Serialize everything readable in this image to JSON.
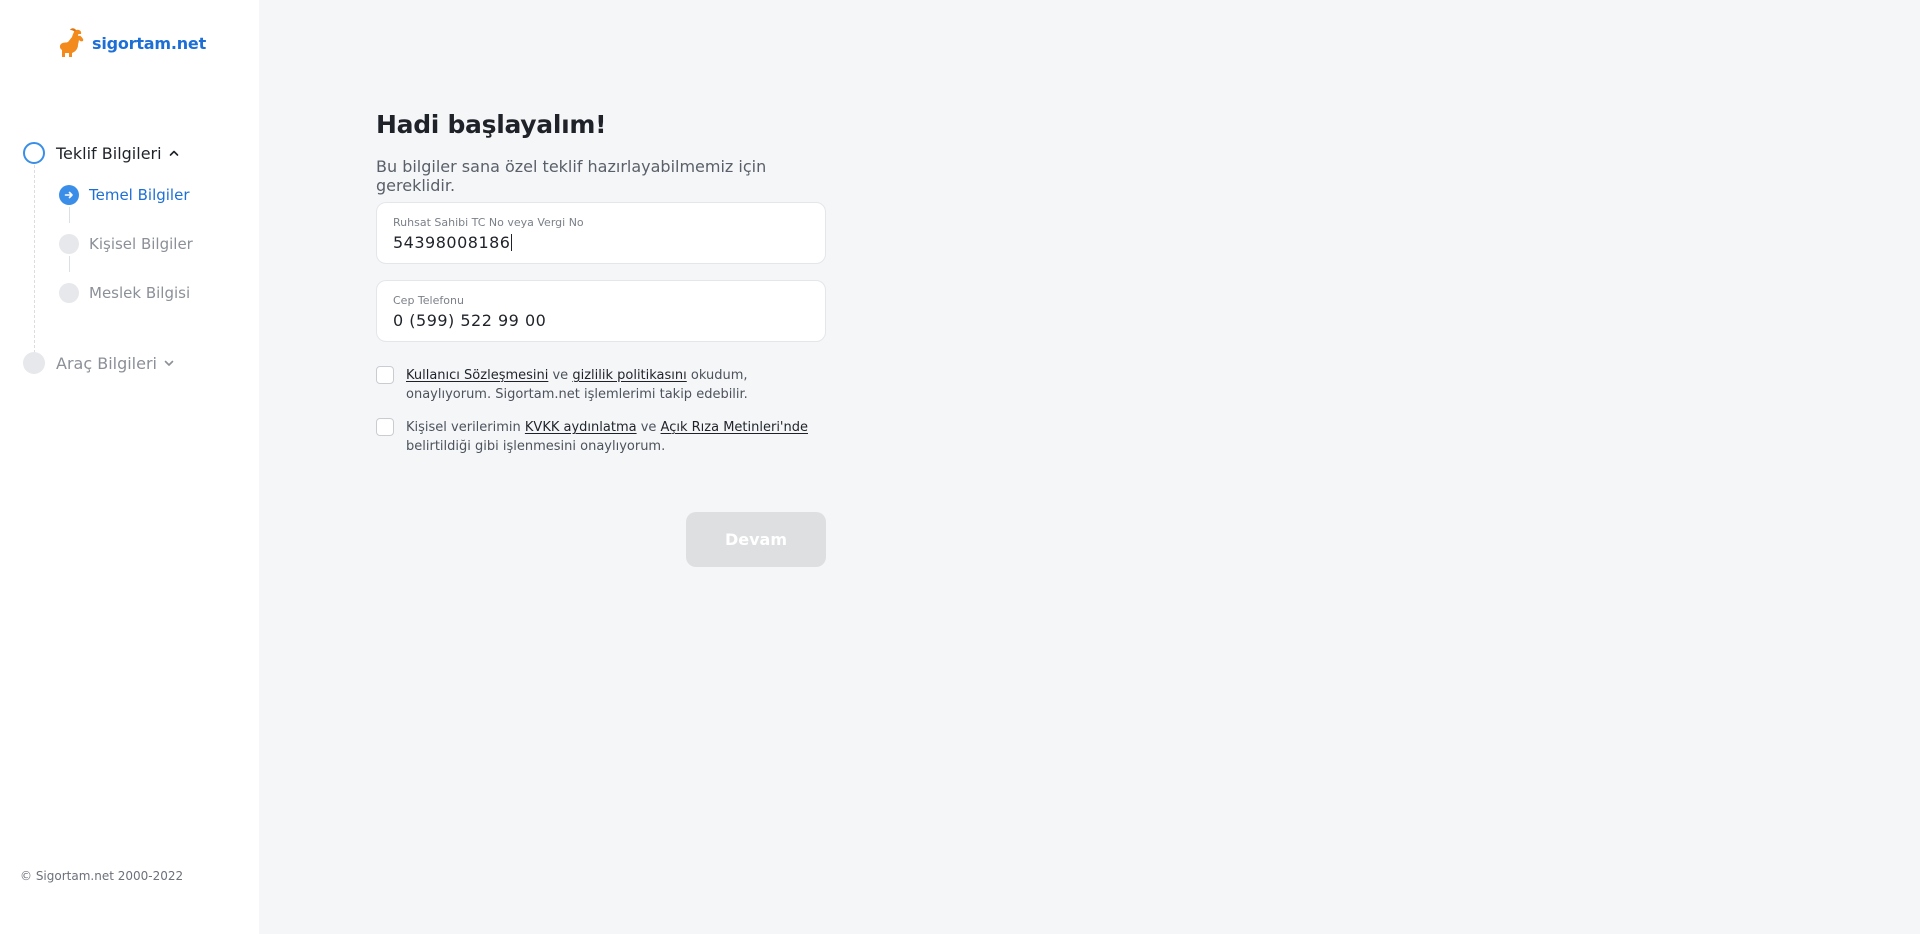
{
  "brand": {
    "name": "sigortam.net",
    "logo_color": "#f28a1e",
    "accent": "#3b8ee8"
  },
  "sidebar": {
    "steps": [
      {
        "label": "Teklif Bilgileri",
        "state": "active",
        "expanded": true,
        "icon": "chevron-up-icon",
        "substeps": [
          {
            "label": "Temel Bilgiler",
            "state": "current",
            "icon": "arrow-right-icon"
          },
          {
            "label": "Kişisel Bilgiler",
            "state": "pending"
          },
          {
            "label": "Meslek Bilgisi",
            "state": "pending"
          }
        ]
      },
      {
        "label": "Araç Bilgileri",
        "state": "pending",
        "expanded": false,
        "icon": "chevron-down-icon"
      }
    ],
    "copyright": "© Sigortam.net 2000-2022"
  },
  "main": {
    "title": "Hadi başlayalım!",
    "subtitle": "Bu bilgiler sana özel teklif hazırlayabilmemiz için gereklidir.",
    "fields": [
      {
        "label": "Ruhsat Sahibi TC No veya Vergi No",
        "value": "54398008186",
        "focused": true
      },
      {
        "label": "Cep Telefonu",
        "value": "0 (599) 522 99 00",
        "focused": false
      }
    ],
    "consents": [
      {
        "checked": false,
        "link1": "Kullanıcı Sözleşmesini",
        "text1": " ve ",
        "link2": "gizlilik politikasını",
        "text2": " okudum, onaylıyorum. Sigortam.net işlemlerimi takip edebilir."
      },
      {
        "checked": false,
        "text0": "Kişisel verilerimin ",
        "link1": "KVKK aydınlatma",
        "text1": " ve ",
        "link2": "Açık Rıza Metinleri'nde",
        "text2": " belirtildiği gibi işlenmesini onaylıyorum."
      }
    ],
    "submit_label": "Devam",
    "submit_disabled": true
  }
}
